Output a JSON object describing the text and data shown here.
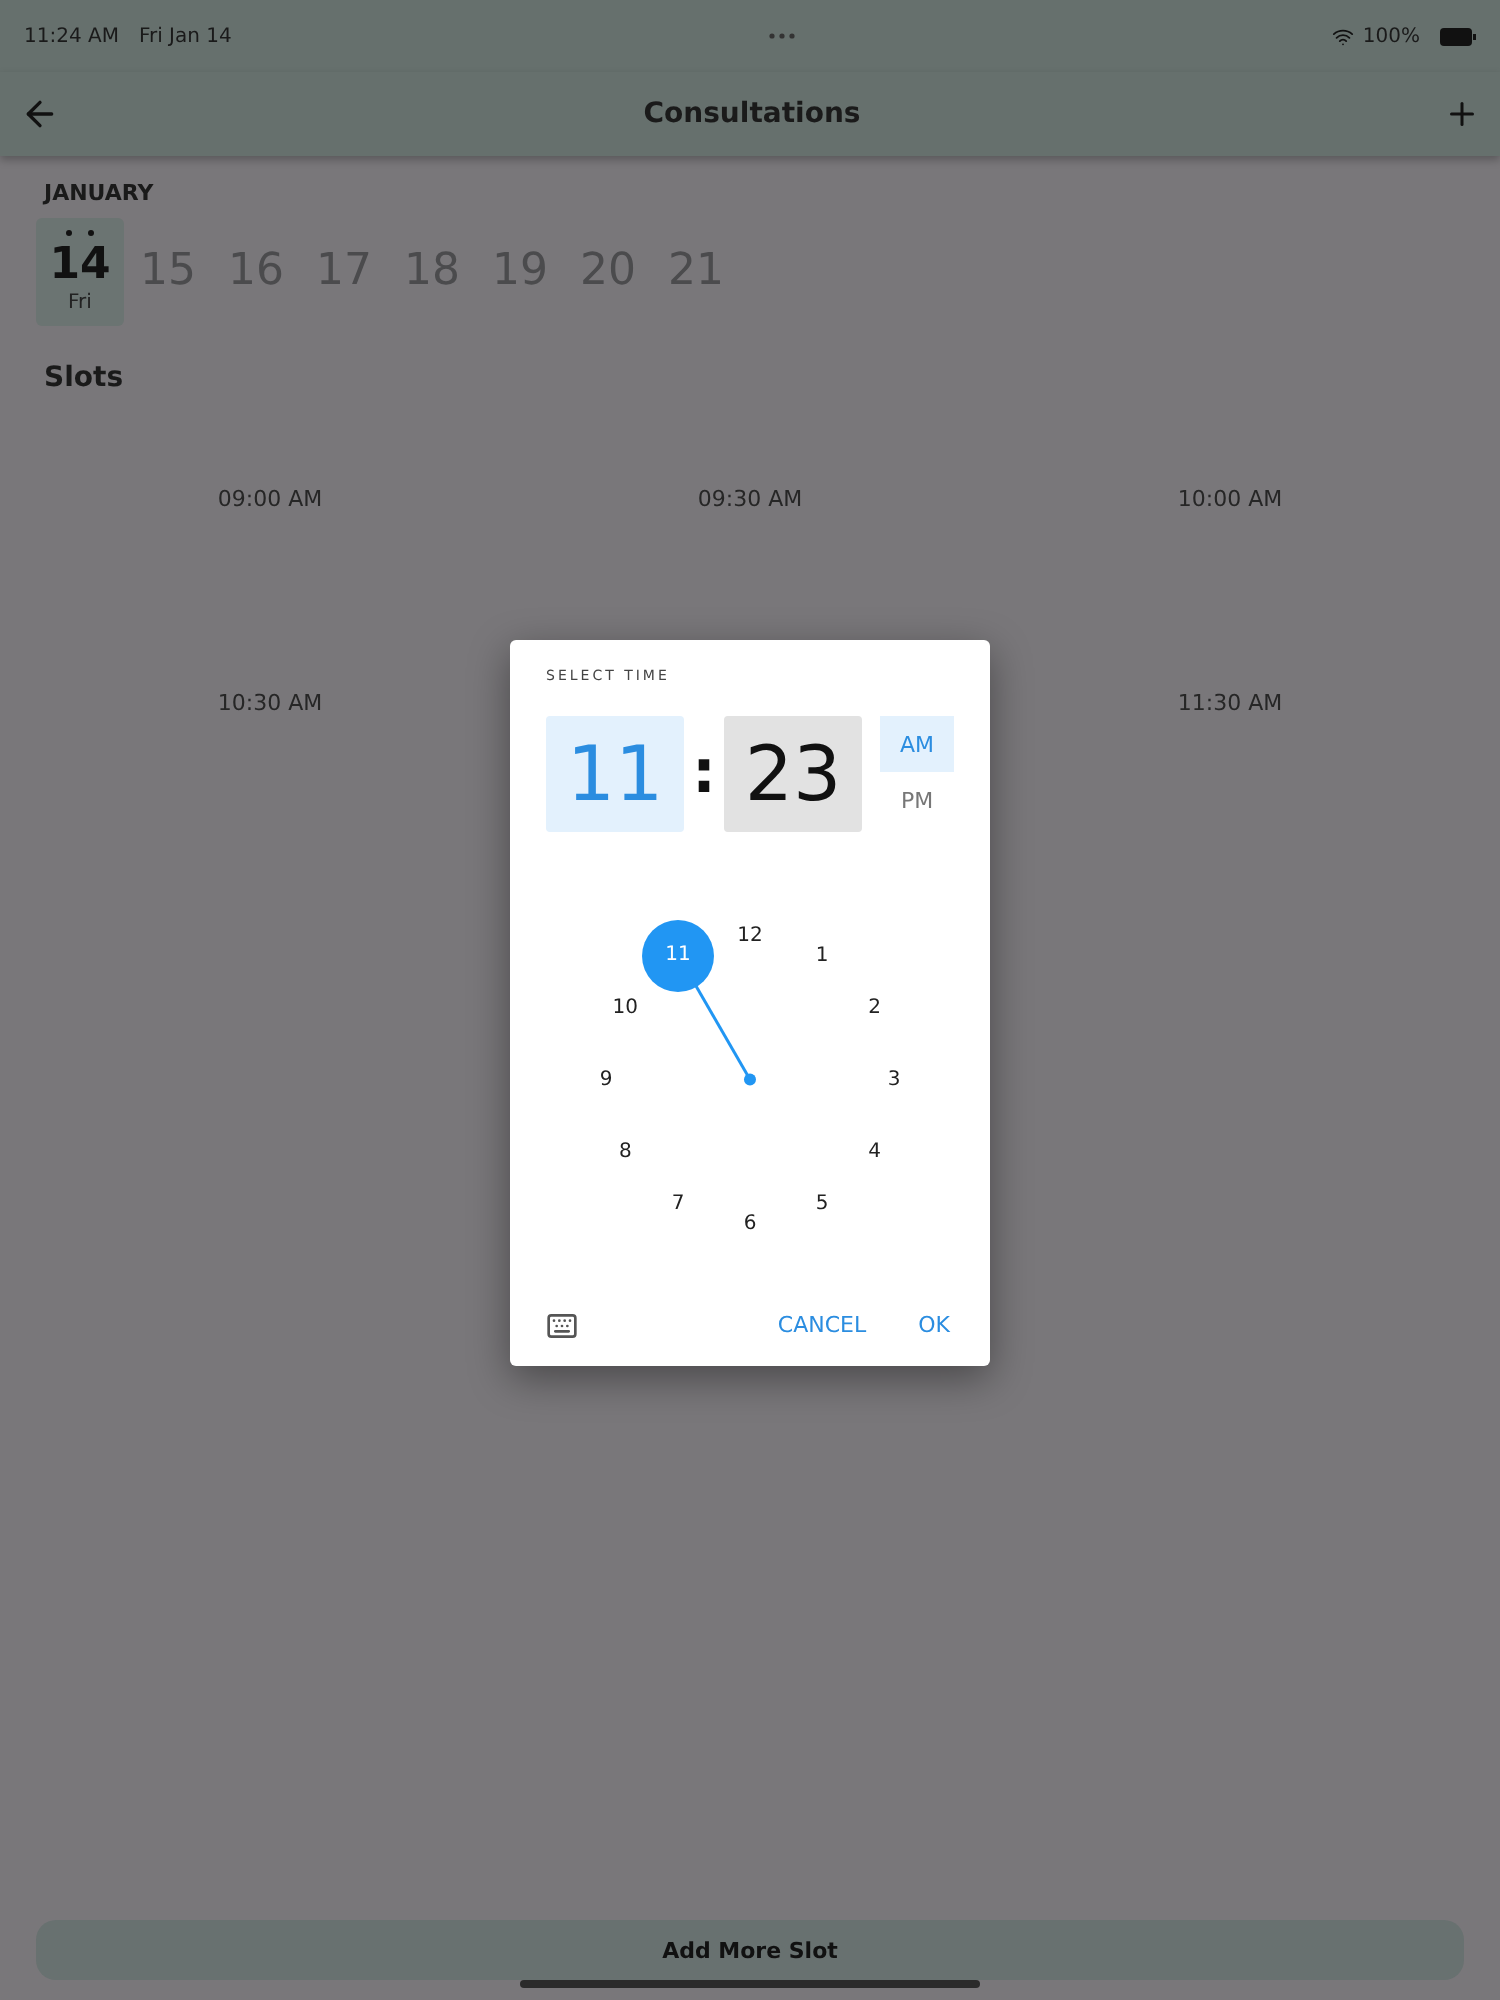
{
  "status_bar": {
    "time": "11:24 AM",
    "date": "Fri Jan 14",
    "battery": "100%"
  },
  "header": {
    "title": "Consultations"
  },
  "month": "JANUARY",
  "dates": [
    {
      "day": "14",
      "weekday": "Fri",
      "marked": true,
      "selected": true
    },
    {
      "day": "15",
      "selected": false
    },
    {
      "day": "16",
      "selected": false
    },
    {
      "day": "17",
      "selected": false
    },
    {
      "day": "18",
      "selected": false
    },
    {
      "day": "19",
      "selected": false
    },
    {
      "day": "20",
      "selected": false
    },
    {
      "day": "21",
      "selected": false
    }
  ],
  "slots_title": "Slots",
  "slots": [
    {
      "kind": "time",
      "time": "09:00 AM"
    },
    {
      "kind": "time",
      "time": "09:30 AM"
    },
    {
      "kind": "time",
      "time": "10:00 AM"
    },
    {
      "kind": "time",
      "time": "10:30 AM"
    },
    {
      "kind": "covered"
    },
    {
      "kind": "time",
      "time": "11:30 AM"
    }
  ],
  "add_button": "Add More Slot",
  "dialog": {
    "title": "SELECT TIME",
    "hour": {
      "value": "11",
      "selected": true
    },
    "separator": ":",
    "minute": {
      "value": "23",
      "selected": false
    },
    "periods": [
      {
        "label": "AM",
        "selected": true
      },
      {
        "label": "PM",
        "selected": false
      }
    ],
    "hours": [
      {
        "label": "12",
        "selected": false
      },
      {
        "label": "1",
        "selected": false
      },
      {
        "label": "2",
        "selected": false
      },
      {
        "label": "3",
        "selected": false
      },
      {
        "label": "4",
        "selected": false
      },
      {
        "label": "5",
        "selected": false
      },
      {
        "label": "6",
        "selected": false
      },
      {
        "label": "7",
        "selected": false
      },
      {
        "label": "8",
        "selected": false
      },
      {
        "label": "9",
        "selected": false
      },
      {
        "label": "10",
        "selected": false
      },
      {
        "label": "11",
        "selected": true
      }
    ],
    "buttons": [
      "CANCEL",
      "OK"
    ]
  }
}
